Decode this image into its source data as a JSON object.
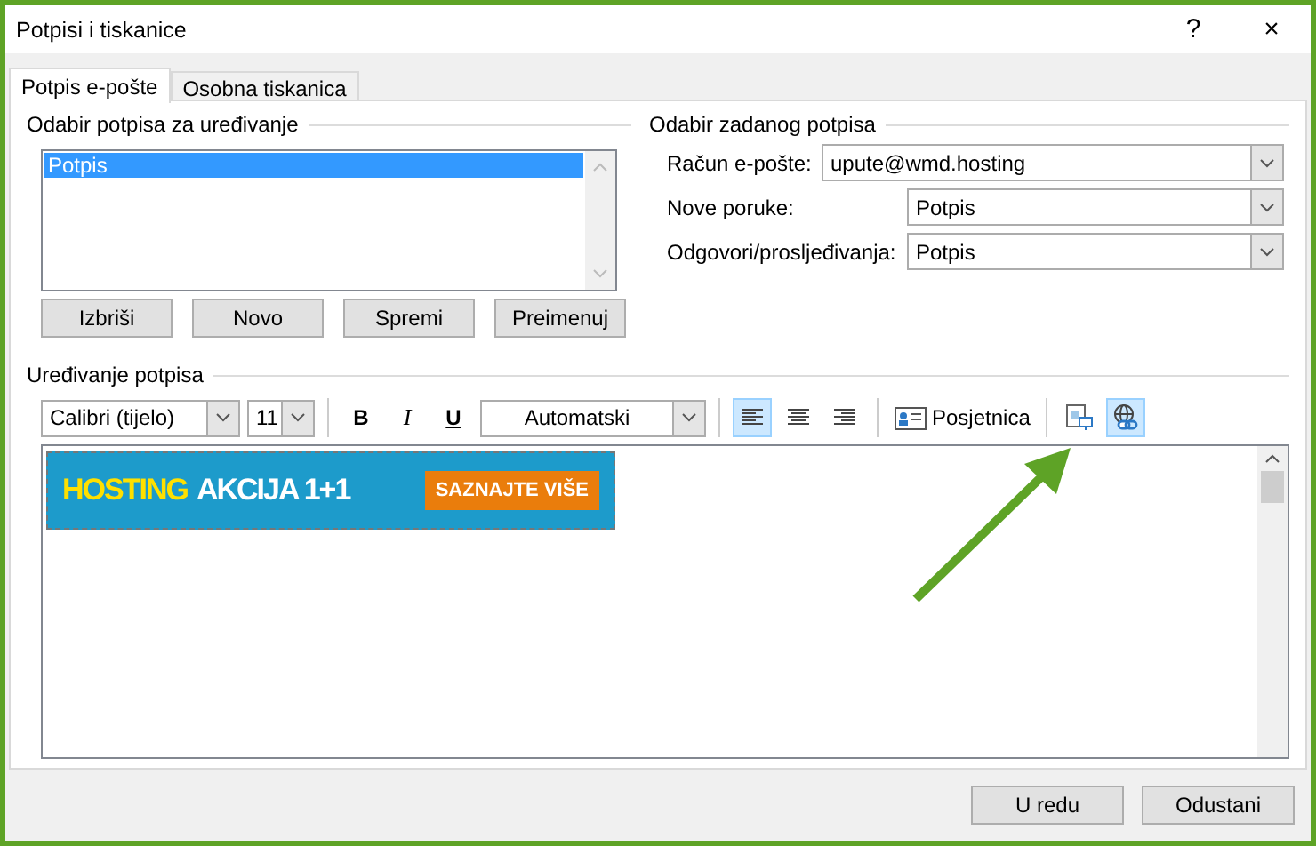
{
  "window": {
    "title": "Potpisi i tiskanice",
    "help": "?",
    "close": "×"
  },
  "tabs": [
    {
      "label": "Potpis e-pošte",
      "selected": true
    },
    {
      "label": "Osobna tiskanica",
      "selected": false
    }
  ],
  "select_signature": {
    "heading": "Odabir potpisa za uređivanje",
    "items": [
      {
        "label": "Potpis",
        "selected": true
      }
    ],
    "buttons": [
      "Izbriši",
      "Novo",
      "Spremi",
      "Preimenuj"
    ]
  },
  "default_signature": {
    "heading": "Odabir zadanog potpisa",
    "fields": [
      {
        "label": "Račun e-pošte:",
        "value": "upute@wmd.hosting"
      },
      {
        "label": "Nove poruke:",
        "value": "Potpis"
      },
      {
        "label": "Odgovori/prosljeđivanja:",
        "value": "Potpis"
      }
    ]
  },
  "edit_signature": {
    "heading": "Uređivanje potpisa",
    "toolbar": {
      "font": "Calibri (tijelo)",
      "size": "11",
      "bold": "B",
      "italic": "I",
      "underline": "U",
      "text_color_choice": "Automatski",
      "align": [
        {
          "kind": "left",
          "selected": true
        },
        {
          "kind": "center",
          "selected": false
        },
        {
          "kind": "right",
          "selected": false
        }
      ],
      "business_card": "Posjetnica",
      "insert": [
        {
          "kind": "picture",
          "highlighted": false
        },
        {
          "kind": "hyperlink",
          "highlighted": true
        }
      ]
    },
    "banner": {
      "headline_1": "HOSTING",
      "headline_2": "AKCIJA 1+1",
      "cta": "SAZNAJTE VIŠE"
    }
  },
  "buttons": [
    "U redu",
    "Odustani"
  ]
}
